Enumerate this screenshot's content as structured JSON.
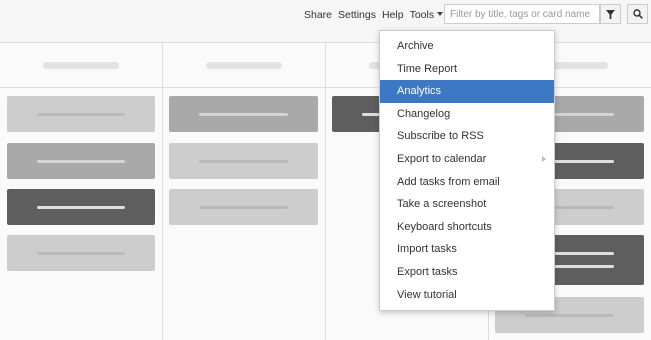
{
  "nav": {
    "share": "Share",
    "settings": "Settings",
    "help": "Help",
    "tools": "Tools"
  },
  "search": {
    "placeholder": "Filter by title, tags or card name",
    "filter_icon": "filter-icon",
    "search_icon": "magnifier-icon"
  },
  "tools_menu": {
    "items": [
      {
        "label": "Archive"
      },
      {
        "label": "Time Report"
      },
      {
        "label": "Analytics",
        "highlighted": true
      },
      {
        "label": "Changelog"
      },
      {
        "label": "Subscribe to RSS"
      },
      {
        "label": "Export to calendar",
        "has_submenu": true
      },
      {
        "label": "Add tasks from email"
      },
      {
        "label": "Take a screenshot"
      },
      {
        "label": "Keyboard shortcuts"
      },
      {
        "label": "Import tasks"
      },
      {
        "label": "Export tasks"
      },
      {
        "label": "View tutorial"
      }
    ]
  },
  "colors": {
    "highlight": "#3c78c3",
    "card_light": "#cdcdcd",
    "card_mid": "#a9a9a9",
    "card_dark": "#5e5e5e"
  }
}
